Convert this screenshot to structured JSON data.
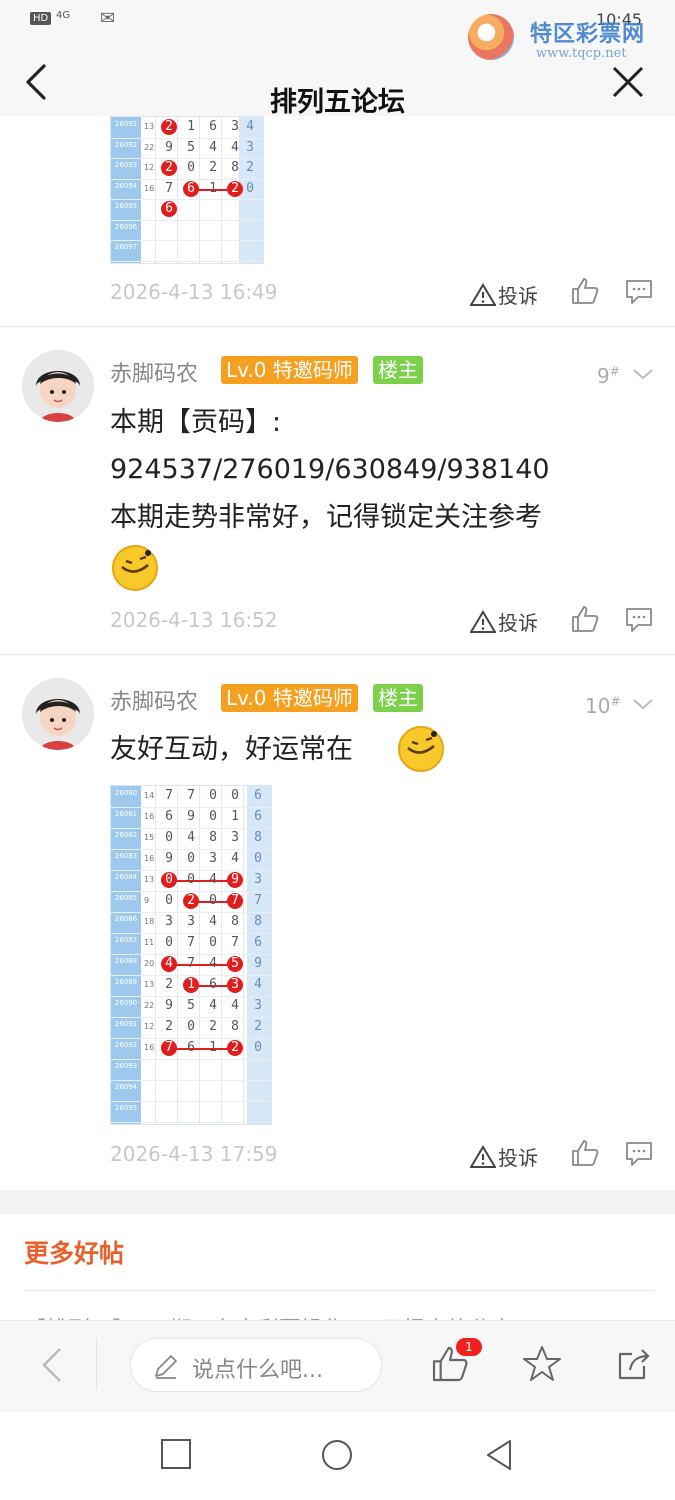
{
  "status_bar": {
    "hd": "HD",
    "network": "4G",
    "time": "10:45"
  },
  "watermark": {
    "title": "特区彩票网",
    "url": "www.tqcp.net"
  },
  "header": {
    "title": "排列五论坛"
  },
  "posts": [
    {
      "time": "2026-4-13 16:49",
      "report": "投诉"
    },
    {
      "user": "赤脚码农",
      "level": "Lv.0 特邀码师",
      "role": "楼主",
      "floor": "9",
      "lines": [
        "本期【贡码】:",
        "924537/276019/630849/938140",
        "本期走势非常好，记得锁定关注参考"
      ],
      "time": "2026-4-13 16:52",
      "report": "投诉"
    },
    {
      "user": "赤脚码农",
      "level": "Lv.0 特邀码师",
      "role": "楼主",
      "floor": "10",
      "text": "友好互动，好运常在",
      "time": "2026-4-13 17:59",
      "report": "投诉"
    }
  ],
  "chart1": {
    "rows": [
      {
        "id": "26091",
        "n": "13",
        "d": [
          "2",
          "1",
          "6",
          "3"
        ],
        "t": "4"
      },
      {
        "id": "26092",
        "n": "22",
        "d": [
          "9",
          "5",
          "4",
          "4"
        ],
        "t": "3"
      },
      {
        "id": "26093",
        "n": "12",
        "d": [
          "2",
          "0",
          "2",
          "8"
        ],
        "t": "2"
      },
      {
        "id": "26094",
        "n": "16",
        "d": [
          "7",
          "6",
          "1",
          "2"
        ],
        "t": "0"
      },
      {
        "id": "26095",
        "n": "",
        "d": [
          "6",
          "",
          "",
          ""
        ],
        "t": ""
      },
      {
        "id": "26096",
        "n": "",
        "d": [
          "",
          "",
          "",
          ""
        ],
        "t": ""
      },
      {
        "id": "26097",
        "n": "",
        "d": [
          "",
          "",
          "",
          ""
        ],
        "t": ""
      }
    ]
  },
  "chart2": {
    "rows": [
      {
        "id": "26080",
        "n": "14",
        "d": [
          "7",
          "7",
          "0",
          "0"
        ],
        "t": "6"
      },
      {
        "id": "26081",
        "n": "16",
        "d": [
          "6",
          "9",
          "0",
          "1"
        ],
        "t": "6"
      },
      {
        "id": "26082",
        "n": "15",
        "d": [
          "0",
          "4",
          "8",
          "3"
        ],
        "t": "8"
      },
      {
        "id": "26083",
        "n": "16",
        "d": [
          "9",
          "0",
          "3",
          "4"
        ],
        "t": "0"
      },
      {
        "id": "26084",
        "n": "13",
        "d": [
          "0",
          "0",
          "4",
          "9"
        ],
        "t": "3"
      },
      {
        "id": "26085",
        "n": "9",
        "d": [
          "0",
          "2",
          "0",
          "7"
        ],
        "t": "7"
      },
      {
        "id": "26086",
        "n": "18",
        "d": [
          "3",
          "3",
          "4",
          "8"
        ],
        "t": "8"
      },
      {
        "id": "26087",
        "n": "11",
        "d": [
          "0",
          "7",
          "0",
          "7"
        ],
        "t": "6"
      },
      {
        "id": "26088",
        "n": "20",
        "d": [
          "4",
          "7",
          "4",
          "5"
        ],
        "t": "9"
      },
      {
        "id": "26089",
        "n": "13",
        "d": [
          "2",
          "1",
          "6",
          "3"
        ],
        "t": "4"
      },
      {
        "id": "26090",
        "n": "22",
        "d": [
          "9",
          "5",
          "4",
          "4"
        ],
        "t": "3"
      },
      {
        "id": "26091",
        "n": "12",
        "d": [
          "2",
          "0",
          "2",
          "8"
        ],
        "t": "2"
      },
      {
        "id": "26092",
        "n": "16",
        "d": [
          "7",
          "6",
          "1",
          "2"
        ],
        "t": "0"
      },
      {
        "id": "26093",
        "n": "",
        "d": [
          "",
          "",
          "",
          ""
        ],
        "t": ""
      },
      {
        "id": "26094",
        "n": "",
        "d": [
          "",
          "",
          "",
          ""
        ],
        "t": ""
      },
      {
        "id": "26095",
        "n": "",
        "d": [
          "",
          "",
          "",
          ""
        ],
        "t": ""
      }
    ]
  },
  "more": {
    "title": "更多好帖",
    "first_item": "【排列五】 … 期 · 东方彩票操作 … 日报走势分享"
  },
  "bottom_bar": {
    "comment_placeholder": "说点什么吧...",
    "like_count": "1"
  },
  "colors": {
    "accent": "#e8612d",
    "level_badge": "#f6a020",
    "host_badge": "#7bd24a",
    "hit_ball": "#e01e1e"
  }
}
